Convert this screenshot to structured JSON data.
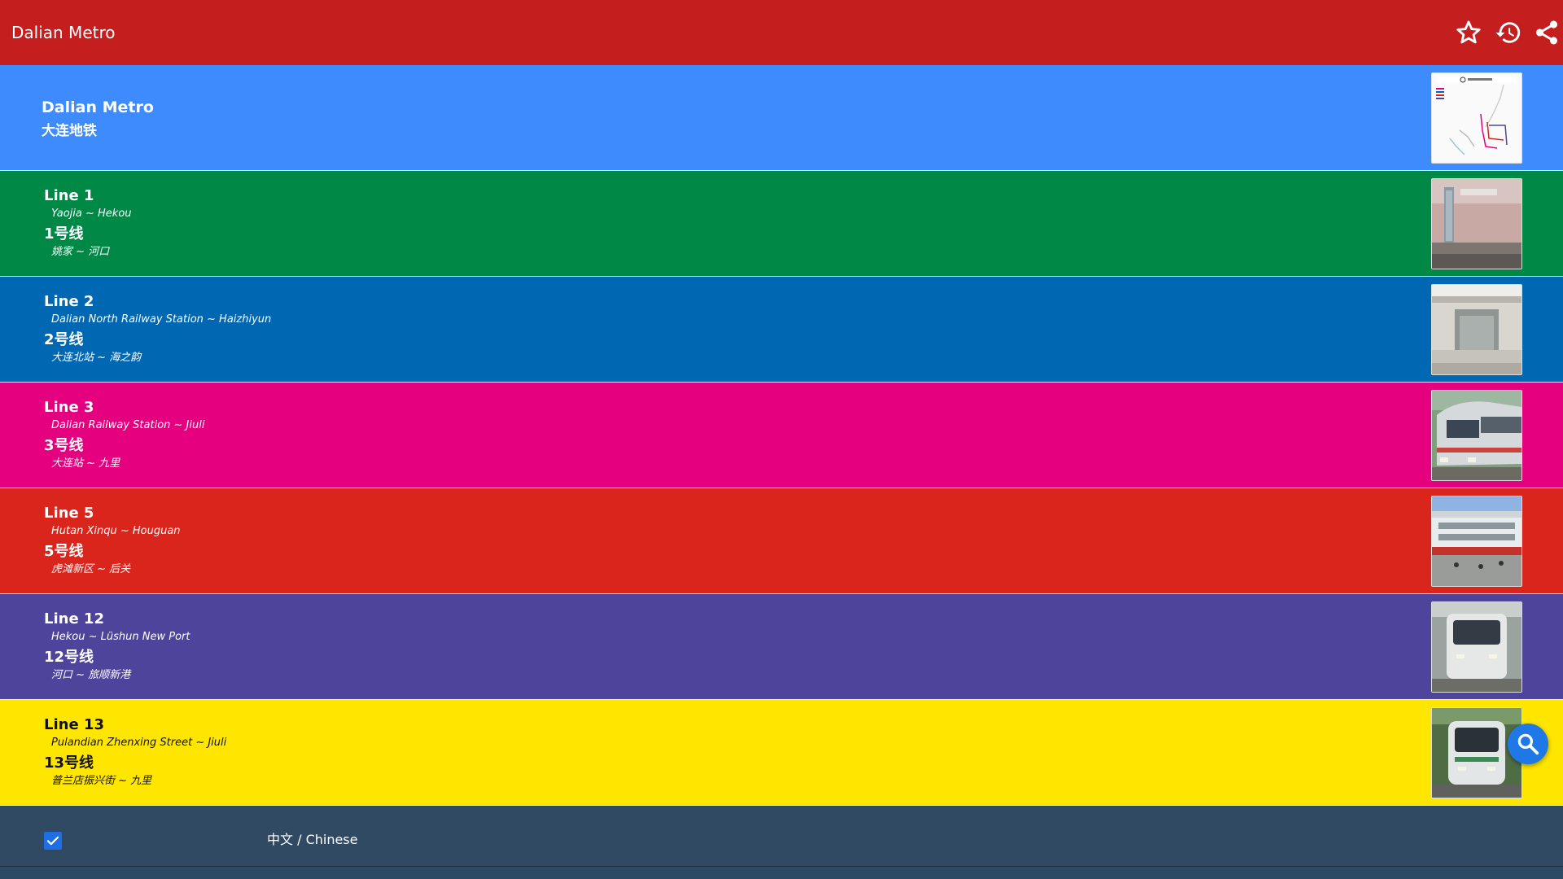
{
  "appbar": {
    "title": "Dalian Metro",
    "icons": [
      "star-icon",
      "history-icon",
      "share-icon"
    ]
  },
  "header": {
    "title_en": "Dalian Metro",
    "title_cn": "大连地铁",
    "bg_color": "#3d8bfd"
  },
  "lines": [
    {
      "name": "Line 1",
      "route_en": "Yaojia ~ Hekou",
      "name_cn": "1号线",
      "route_cn": "姚家 ~ 河口",
      "color": "#008847"
    },
    {
      "name": "Line 2",
      "route_en": "Dalian North Railway Station ~ Haizhiyun",
      "name_cn": "2号线",
      "route_cn": "大连北站 ~ 海之韵",
      "color": "#0068b2"
    },
    {
      "name": "Line 3",
      "route_en": "Dalian Railway Station ~ Jiuli",
      "name_cn": "3号线",
      "route_cn": "大连站 ~ 九里",
      "color": "#e4007f"
    },
    {
      "name": "Line 5",
      "route_en": "Hutan Xinqu ~ Houguan",
      "name_cn": "5号线",
      "route_cn": "虎滩新区 ~ 后关",
      "color": "#d9251c"
    },
    {
      "name": "Line 12",
      "route_en": "Hekou ~ Lüshun New Port",
      "name_cn": "12号线",
      "route_cn": "河口 ~ 旅顺新港",
      "color": "#4f449b"
    },
    {
      "name": "Line 13",
      "route_en": "Pulandian Zhenxing Street ~ Jiuli",
      "name_cn": "13号线",
      "route_cn": "普兰店振兴街 ~ 九里",
      "color": "#ffe600"
    }
  ],
  "footer": {
    "checkbox_checked": true,
    "label": "中文 / Chinese"
  },
  "fab": {
    "icon": "search-icon"
  },
  "colors": {
    "appbar": "#c41e1e",
    "footer": "#2f4a62",
    "accent": "#1e78e6"
  }
}
